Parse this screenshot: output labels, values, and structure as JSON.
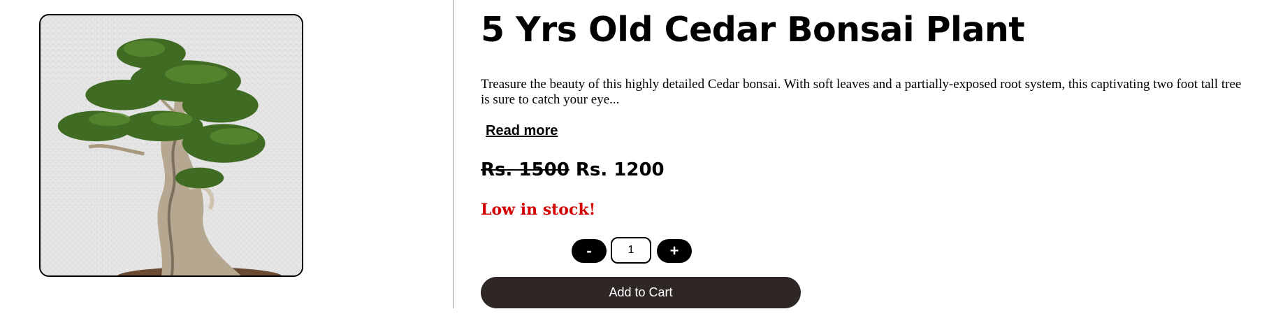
{
  "product": {
    "title": "5 Yrs Old Cedar Bonsai Plant",
    "description": "Treasure the beauty of this highly detailed Cedar bonsai. With soft leaves and a partially-exposed root system, this captivating two foot tall tree is sure to catch your eye...",
    "read_more_label": "Read more",
    "price_original": "Rs. 1500",
    "price_current": "Rs. 1200",
    "stock_status": "Low in stock!",
    "stock_color": "#d40000",
    "image_icon": "bonsai-tree-photo"
  },
  "quantity": {
    "decrement_label": "-",
    "value": "1",
    "increment_label": "+"
  },
  "cart": {
    "add_label": "Add to Cart",
    "button_color": "#2f2726"
  }
}
